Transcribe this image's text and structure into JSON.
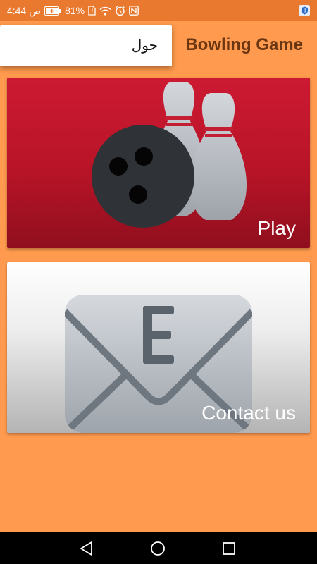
{
  "status_bar": {
    "time": "4:44 ص",
    "battery_percent": "81%",
    "icons": [
      "battery-icon",
      "sim-alert-icon",
      "wifi-icon",
      "alarm-icon",
      "nfc-icon",
      "shield-icon"
    ]
  },
  "app_bar": {
    "title": "Bowling Game"
  },
  "menu": {
    "items": [
      {
        "label": "حول"
      }
    ]
  },
  "cards": [
    {
      "label": "Play",
      "icon": "bowling-icon"
    },
    {
      "label": "Contact us",
      "icon": "envelope-icon"
    }
  ],
  "nav_bar": {
    "buttons": [
      "back-icon",
      "home-icon",
      "recents-icon"
    ]
  },
  "colors": {
    "background": "#FF9A4E",
    "status_bar": "#E8792F",
    "title_text": "#6B3612",
    "play_card": "#C4172E"
  }
}
